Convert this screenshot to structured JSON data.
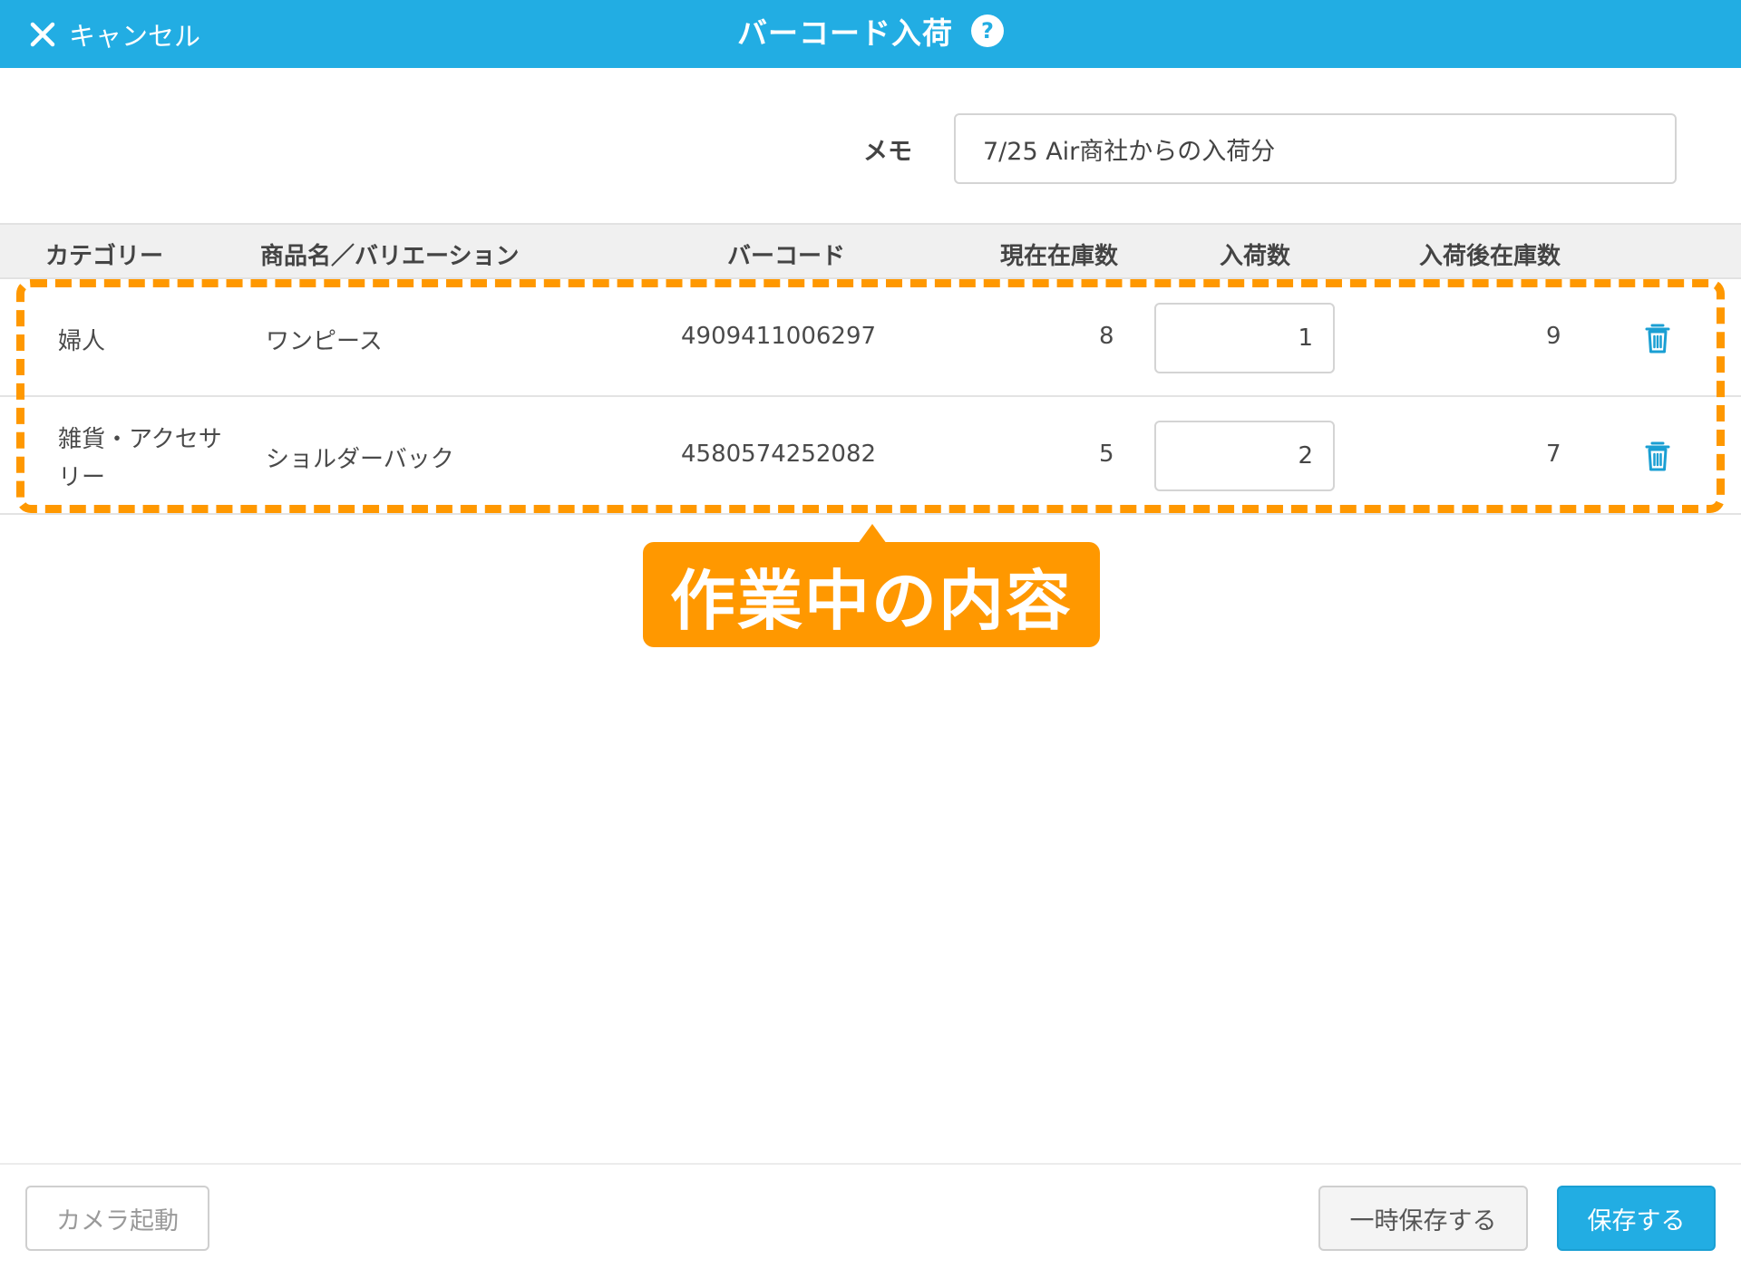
{
  "header": {
    "cancel_label": "キャンセル",
    "title": "バーコード入荷",
    "help_icon": "?"
  },
  "memo": {
    "label": "メモ",
    "value": "7/25 Air商社からの入荷分"
  },
  "table": {
    "columns": [
      "カテゴリー",
      "商品名／バリエーション",
      "バーコード",
      "現在在庫数",
      "入荷数",
      "入荷後在庫数"
    ],
    "rows": [
      {
        "category_line1": "婦人",
        "category_line2": "",
        "product": "ワンピース",
        "barcode": "4909411006297",
        "current_stock": "8",
        "qty": "1",
        "after_stock": "9"
      },
      {
        "category_line1": "雑貨・アクセサ",
        "category_line2": "リー",
        "product": "ショルダーバック",
        "barcode": "4580574252082",
        "current_stock": "5",
        "qty": "2",
        "after_stock": "7"
      }
    ]
  },
  "annotation": {
    "callout_text": "作業中の内容",
    "color": "#ff9800"
  },
  "footer": {
    "camera_label": "カメラ起動",
    "temp_save_label": "一時保存する",
    "save_label": "保存する"
  },
  "colors": {
    "accent": "#22ade3",
    "highlight": "#ff9800"
  }
}
